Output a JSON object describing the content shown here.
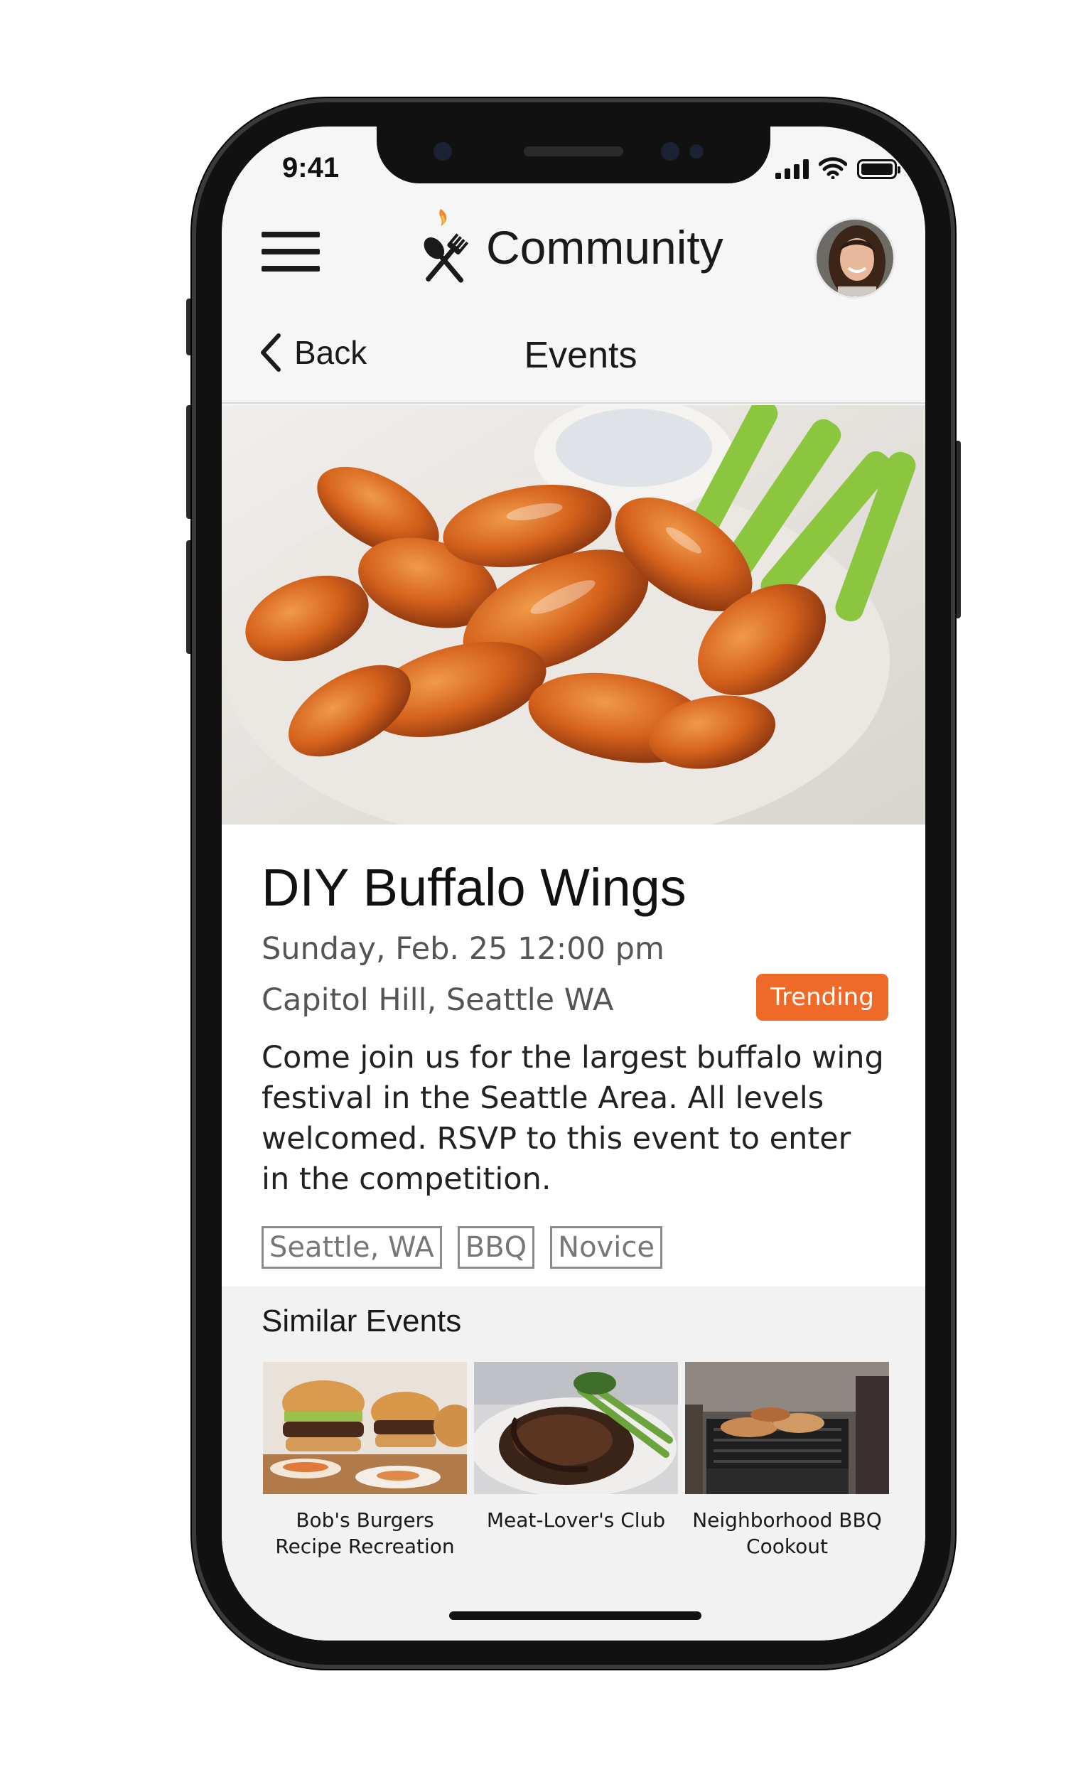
{
  "status_bar": {
    "time": "9:41"
  },
  "header": {
    "app_title": "Community",
    "logo_icon": "fork-spoon-flame-icon",
    "menu_icon": "hamburger-menu-icon",
    "avatar_icon": "user-avatar"
  },
  "nav": {
    "back_label": "Back",
    "title": "Events"
  },
  "hero": {
    "image_subject": "buffalo-wings-photo"
  },
  "event": {
    "title": "DIY Buffalo Wings",
    "date": "Sunday, Feb. 25 12:00 pm",
    "location": "Capitol Hill, Seattle WA",
    "badge": "Trending",
    "description": "Come join us for the largest buffalo wing festival in the Seattle Area. All levels welcomed. RSVP to this event to enter in the competition.",
    "tags": [
      "Seattle, WA",
      "BBQ",
      "Novice"
    ]
  },
  "similar": {
    "title": "Similar Events",
    "items": [
      {
        "label_line1": "Bob's Burgers",
        "label_line2": "Recipe Recreation"
      },
      {
        "label_line1": "Meat-Lover's Club",
        "label_line2": ""
      },
      {
        "label_line1": "Neighborhood BBQ",
        "label_line2": "Cookout"
      }
    ]
  },
  "colors": {
    "accent": "#ef6a28",
    "screen_bg": "#f6f6f6",
    "text": "#1f1f1f"
  }
}
